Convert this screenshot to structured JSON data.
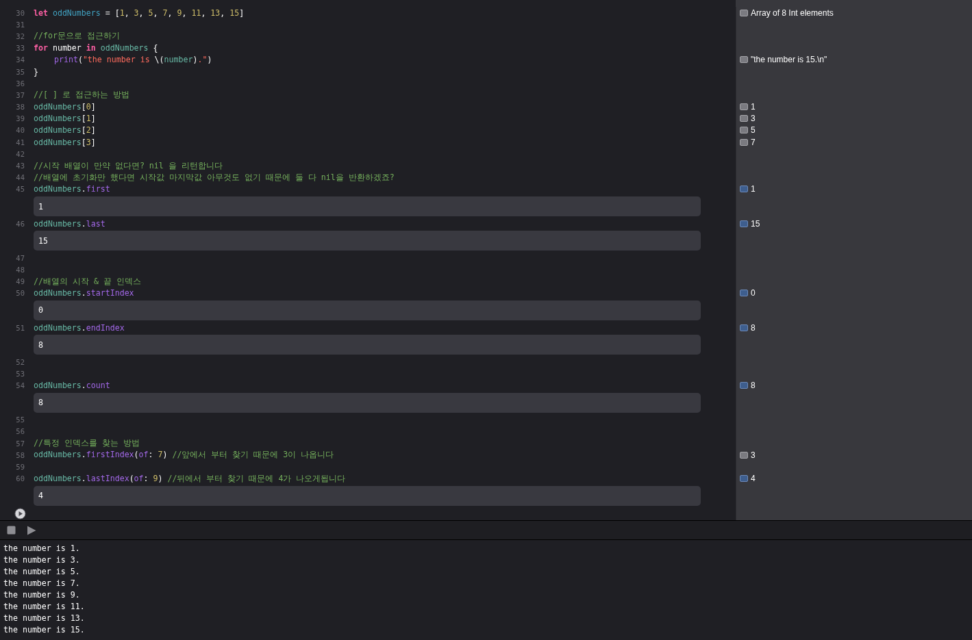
{
  "editor": {
    "lines": [
      {
        "number": "30",
        "tokens": [
          {
            "text": "let ",
            "kind": "keyword"
          },
          {
            "text": "oddNumbers",
            "kind": "decl"
          },
          {
            "text": " = [",
            "kind": "plain"
          },
          {
            "text": "1",
            "kind": "number"
          },
          {
            "text": ", ",
            "kind": "plain"
          },
          {
            "text": "3",
            "kind": "number"
          },
          {
            "text": ", ",
            "kind": "plain"
          },
          {
            "text": "5",
            "kind": "number"
          },
          {
            "text": ", ",
            "kind": "plain"
          },
          {
            "text": "7",
            "kind": "number"
          },
          {
            "text": ", ",
            "kind": "plain"
          },
          {
            "text": "9",
            "kind": "number"
          },
          {
            "text": ", ",
            "kind": "plain"
          },
          {
            "text": "11",
            "kind": "number"
          },
          {
            "text": ", ",
            "kind": "plain"
          },
          {
            "text": "13",
            "kind": "number"
          },
          {
            "text": ", ",
            "kind": "plain"
          },
          {
            "text": "15",
            "kind": "number"
          },
          {
            "text": "]",
            "kind": "plain"
          }
        ],
        "result": {
          "text": "Array of 8 Int elements",
          "expanded": false
        }
      },
      {
        "number": "31"
      },
      {
        "number": "32",
        "tokens": [
          {
            "text": "//for문으로 접근하기",
            "kind": "comment"
          }
        ]
      },
      {
        "number": "33",
        "tokens": [
          {
            "text": "for",
            "kind": "keyword"
          },
          {
            "text": " number ",
            "kind": "plain"
          },
          {
            "text": "in",
            "kind": "keyword"
          },
          {
            "text": " oddNumbers",
            "kind": "var"
          },
          {
            "text": " {",
            "kind": "plain"
          }
        ]
      },
      {
        "number": "34",
        "indented": true,
        "tokens": [
          {
            "text": "print",
            "kind": "func"
          },
          {
            "text": "(",
            "kind": "plain"
          },
          {
            "text": "\"the number is ",
            "kind": "string"
          },
          {
            "text": "\\(",
            "kind": "plain"
          },
          {
            "text": "number",
            "kind": "var"
          },
          {
            "text": ")",
            "kind": "plain"
          },
          {
            "text": ".\"",
            "kind": "string"
          },
          {
            "text": ")",
            "kind": "plain"
          }
        ],
        "result": {
          "text": "\"the number is 15.\\n\"",
          "expanded": false
        }
      },
      {
        "number": "35",
        "tokens": [
          {
            "text": "}",
            "kind": "plain"
          }
        ]
      },
      {
        "number": "36"
      },
      {
        "number": "37",
        "tokens": [
          {
            "text": "//[ ] 로 접근하는 방법",
            "kind": "comment"
          }
        ]
      },
      {
        "number": "38",
        "tokens": [
          {
            "text": "oddNumbers",
            "kind": "var"
          },
          {
            "text": "[",
            "kind": "plain"
          },
          {
            "text": "0",
            "kind": "number"
          },
          {
            "text": "]",
            "kind": "plain"
          }
        ],
        "result": {
          "text": "1",
          "expanded": false
        }
      },
      {
        "number": "39",
        "tokens": [
          {
            "text": "oddNumbers",
            "kind": "var"
          },
          {
            "text": "[",
            "kind": "plain"
          },
          {
            "text": "1",
            "kind": "number"
          },
          {
            "text": "]",
            "kind": "plain"
          }
        ],
        "result": {
          "text": "3",
          "expanded": false
        }
      },
      {
        "number": "40",
        "tokens": [
          {
            "text": "oddNumbers",
            "kind": "var"
          },
          {
            "text": "[",
            "kind": "plain"
          },
          {
            "text": "2",
            "kind": "number"
          },
          {
            "text": "]",
            "kind": "plain"
          }
        ],
        "result": {
          "text": "5",
          "expanded": false
        }
      },
      {
        "number": "41",
        "tokens": [
          {
            "text": "oddNumbers",
            "kind": "var"
          },
          {
            "text": "[",
            "kind": "plain"
          },
          {
            "text": "3",
            "kind": "number"
          },
          {
            "text": "]",
            "kind": "plain"
          }
        ],
        "result": {
          "text": "7",
          "expanded": false
        }
      },
      {
        "number": "42"
      },
      {
        "number": "43",
        "tokens": [
          {
            "text": "//시작 배열이 만약 없다면? nil 을 리턴합니다",
            "kind": "comment"
          }
        ]
      },
      {
        "number": "44",
        "tokens": [
          {
            "text": "//배열에 초기화만 했다면 시작값 마지막값 아무것도 없기 때문에 둘 다 nil을 반환하겠죠?",
            "kind": "comment"
          }
        ]
      },
      {
        "number": "45",
        "tokens": [
          {
            "text": "oddNumbers",
            "kind": "var"
          },
          {
            "text": ".",
            "kind": "plain"
          },
          {
            "text": "first",
            "kind": "func"
          }
        ],
        "result": {
          "text": "1",
          "expanded": true,
          "inline": "1"
        }
      },
      {
        "number": "46",
        "tokens": [
          {
            "text": "oddNumbers",
            "kind": "var"
          },
          {
            "text": ".",
            "kind": "plain"
          },
          {
            "text": "last",
            "kind": "func"
          }
        ],
        "result": {
          "text": "15",
          "expanded": true,
          "inline": "15"
        }
      },
      {
        "number": "47"
      },
      {
        "number": "48"
      },
      {
        "number": "49",
        "tokens": [
          {
            "text": "//배열의 시작 & 끝 인덱스",
            "kind": "comment"
          }
        ]
      },
      {
        "number": "50",
        "tokens": [
          {
            "text": "oddNumbers",
            "kind": "var"
          },
          {
            "text": ".",
            "kind": "plain"
          },
          {
            "text": "startIndex",
            "kind": "func"
          }
        ],
        "result": {
          "text": "0",
          "expanded": true,
          "inline": "0"
        }
      },
      {
        "number": "51",
        "tokens": [
          {
            "text": "oddNumbers",
            "kind": "var"
          },
          {
            "text": ".",
            "kind": "plain"
          },
          {
            "text": "endIndex",
            "kind": "func"
          }
        ],
        "result": {
          "text": "8",
          "expanded": true,
          "inline": "8"
        }
      },
      {
        "number": "52"
      },
      {
        "number": "53"
      },
      {
        "number": "54",
        "tokens": [
          {
            "text": "oddNumbers",
            "kind": "var"
          },
          {
            "text": ".",
            "kind": "plain"
          },
          {
            "text": "count",
            "kind": "func"
          }
        ],
        "result": {
          "text": "8",
          "expanded": true,
          "inline": "8"
        }
      },
      {
        "number": "55"
      },
      {
        "number": "56"
      },
      {
        "number": "57",
        "tokens": [
          {
            "text": "//특정 인덱스를 찾는 방법",
            "kind": "comment"
          }
        ]
      },
      {
        "number": "58",
        "tokens": [
          {
            "text": "oddNumbers",
            "kind": "var"
          },
          {
            "text": ".",
            "kind": "plain"
          },
          {
            "text": "firstIndex",
            "kind": "func"
          },
          {
            "text": "(",
            "kind": "plain"
          },
          {
            "text": "of",
            "kind": "func"
          },
          {
            "text": ": ",
            "kind": "plain"
          },
          {
            "text": "7",
            "kind": "number"
          },
          {
            "text": ") ",
            "kind": "plain"
          },
          {
            "text": "//앞에서 부터 찾기 때문에 3이 나옵니다",
            "kind": "comment"
          }
        ],
        "result": {
          "text": "3",
          "expanded": false
        }
      },
      {
        "number": "59"
      },
      {
        "number": "60",
        "tokens": [
          {
            "text": "oddNumbers",
            "kind": "var"
          },
          {
            "text": ".",
            "kind": "plain"
          },
          {
            "text": "lastIndex",
            "kind": "func"
          },
          {
            "text": "(",
            "kind": "plain"
          },
          {
            "text": "of",
            "kind": "func"
          },
          {
            "text": ": ",
            "kind": "plain"
          },
          {
            "text": "9",
            "kind": "number"
          },
          {
            "text": ") ",
            "kind": "plain"
          },
          {
            "text": "//뒤에서 부터 찾기 때문에 4가 나오게됩니다",
            "kind": "comment"
          }
        ],
        "result": {
          "text": "4",
          "expanded": true,
          "inline": "4"
        }
      }
    ]
  },
  "console": {
    "lines": [
      "the number is 1.",
      "the number is 3.",
      "the number is 5.",
      "the number is 7.",
      "the number is 9.",
      "the number is 11.",
      "the number is 13.",
      "the number is 15."
    ]
  }
}
